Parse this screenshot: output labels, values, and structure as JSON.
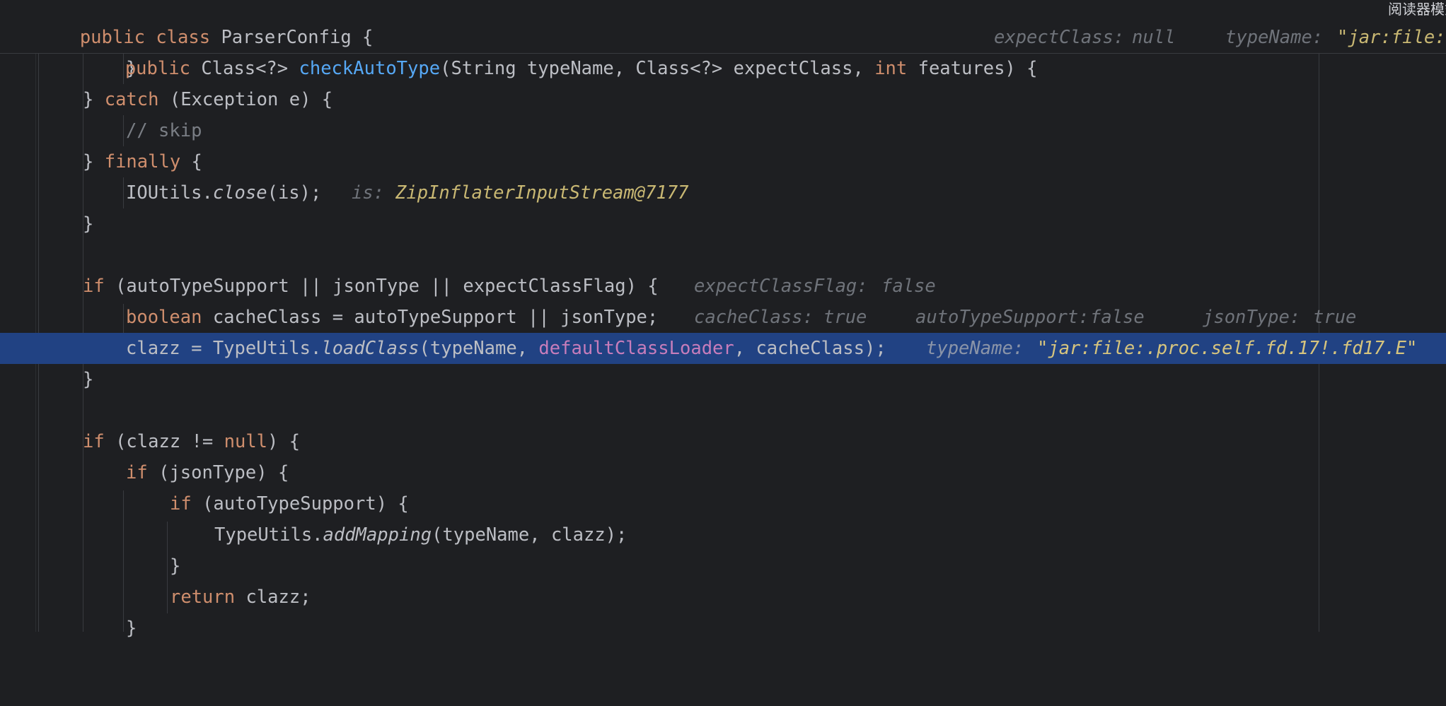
{
  "sticky_header": {
    "class_line": {
      "kw_public": "public",
      "kw_class": "class",
      "class_name": "ParserConfig {"
    },
    "method_line": {
      "kw_public": "public",
      "return_type": "Class<?>",
      "method_name": "checkAutoType",
      "params_a": "(String typeName, Class<?> expectClass, ",
      "kw_int": "int",
      "params_b": " features) {",
      "hint1_label": "expectClass:",
      "hint1_value": "null",
      "hint2_label": "typeName:",
      "hint2_value": "\"jar:file:"
    }
  },
  "reader_mode_label": "阅读器模式",
  "lines": {
    "l1": {
      "brace": "}"
    },
    "l2": {
      "a": "} ",
      "kw": "catch",
      "b": " (Exception e) {"
    },
    "l3": {
      "comment": "// skip"
    },
    "l4": {
      "a": "} ",
      "kw": "finally",
      "b": " {"
    },
    "l5": {
      "a": "IOUtils.",
      "call": "close",
      "b": "(is);",
      "hint_label": "is:",
      "hint_value": "ZipInflaterInputStream@7177"
    },
    "l6": {
      "brace": "}"
    },
    "l8": {
      "kw": "if",
      "b": " (autoTypeSupport || jsonType || expectClassFlag) {",
      "hint_label": "expectClassFlag:",
      "hint_value": "false"
    },
    "l9": {
      "kw": "boolean",
      "b": " cacheClass = autoTypeSupport || jsonType;",
      "h1_label": "cacheClass:",
      "h1_value": "true",
      "h2_label": "autoTypeSupport:",
      "h2_value": "false",
      "h3_label": "jsonType:",
      "h3_value": "true"
    },
    "l10": {
      "a": "clazz = TypeUtils.",
      "call": "loadClass",
      "b": "(typeName, ",
      "field": "defaultClassLoader",
      "c": ", cacheClass);",
      "hint_label": "typeName:",
      "hint_value": "\"jar:file:.proc.self.fd.17!.fd17.E\""
    },
    "l11": {
      "brace": "}"
    },
    "l13": {
      "kw": "if",
      "b": " (clazz != ",
      "kw2": "null",
      "c": ") {"
    },
    "l14": {
      "kw": "if",
      "b": " (jsonType) {"
    },
    "l15": {
      "kw": "if",
      "b": " (autoTypeSupport) {"
    },
    "l16": {
      "a": "TypeUtils.",
      "call": "addMapping",
      "b": "(typeName, clazz);"
    },
    "l17": {
      "brace": "}"
    },
    "l18": {
      "kw": "return",
      "b": " clazz;"
    },
    "l19": {
      "brace": "}"
    }
  },
  "colors": {
    "background": "#1e1f22",
    "keyword": "#cf8e6d",
    "method": "#56a8f5",
    "field": "#c77dbb",
    "comment": "#7a7e85",
    "hint_label": "#6f737a",
    "hint_value": "#c9b873",
    "execution_line": "#214283"
  }
}
